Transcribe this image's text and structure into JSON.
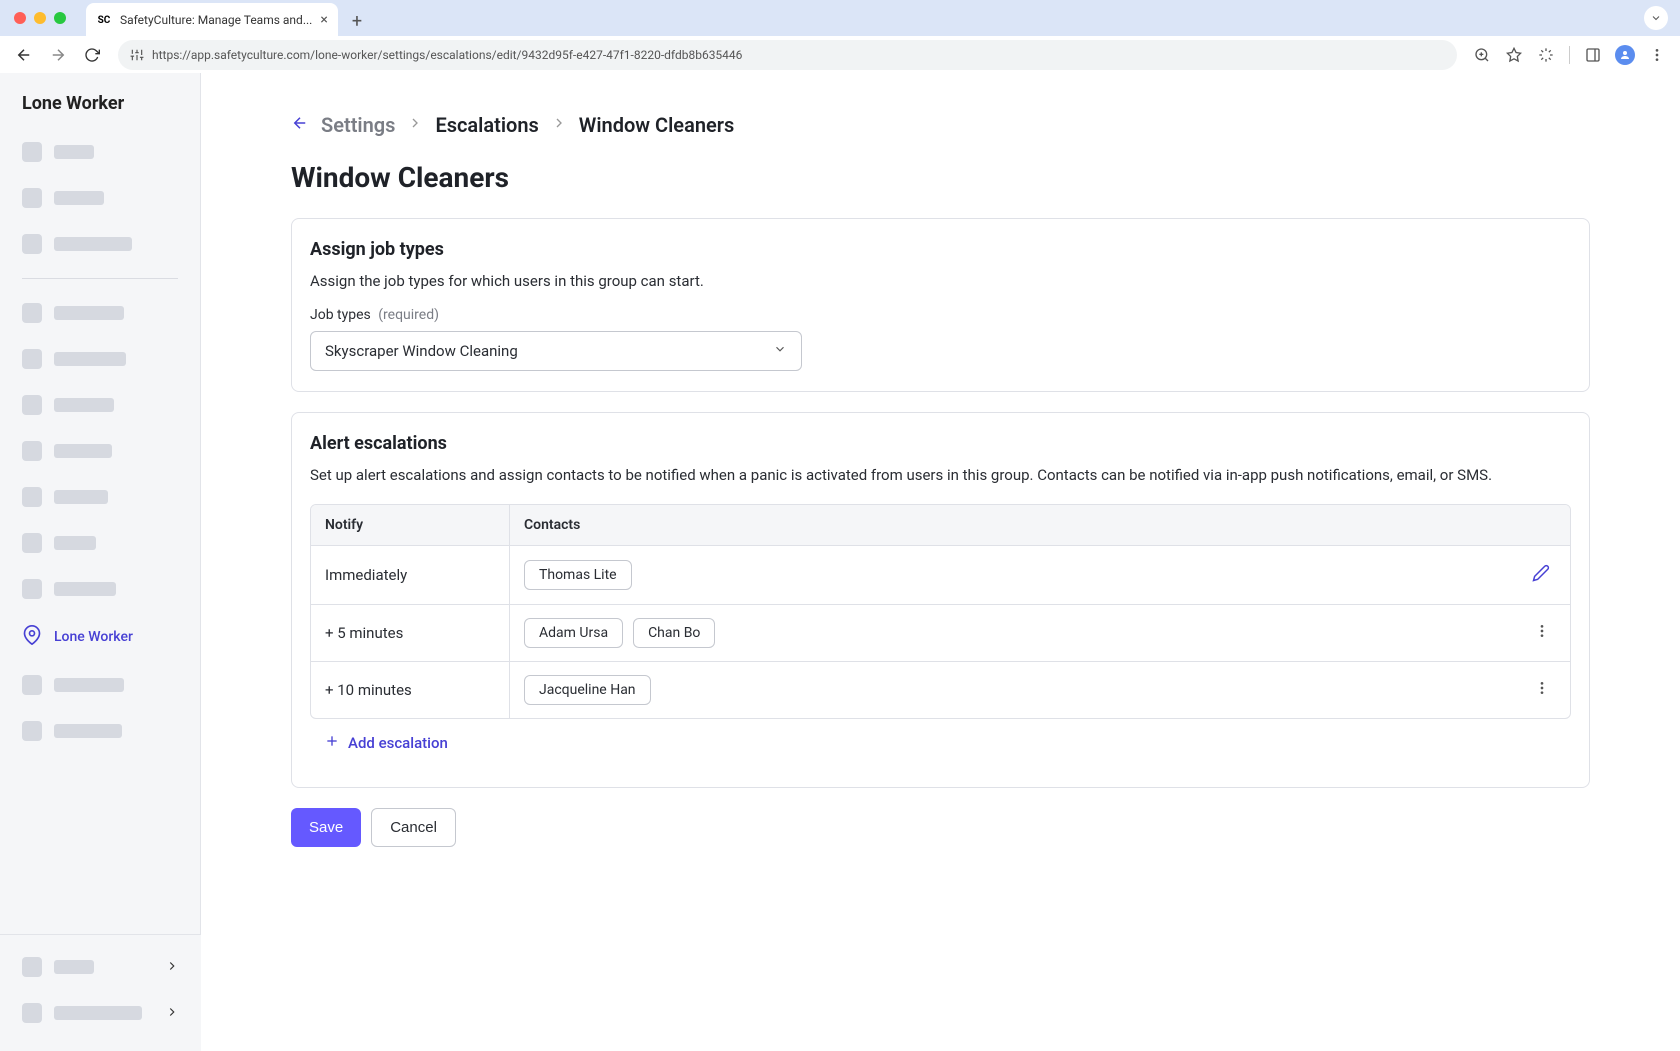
{
  "browser": {
    "tab_title": "SafetyCulture: Manage Teams and...",
    "url": "https://app.safetyculture.com/lone-worker/settings/escalations/edit/9432d95f-e427-47f1-8220-dfdb8b635446"
  },
  "sidebar": {
    "title": "Lone Worker",
    "active_label": "Lone Worker"
  },
  "breadcrumb": {
    "items": [
      {
        "label": "Settings"
      },
      {
        "label": "Escalations"
      },
      {
        "label": "Window Cleaners"
      }
    ]
  },
  "page_title": "Window Cleaners",
  "job_types": {
    "title": "Assign job types",
    "description": "Assign the job types for which users in this group can start.",
    "label": "Job types",
    "required": "(required)",
    "selected": "Skyscraper Window Cleaning"
  },
  "escalations": {
    "title": "Alert escalations",
    "description": "Set up alert escalations and assign contacts to be notified when a panic is activated from users in this group. Contacts can be notified via in-app push notifications, email, or SMS.",
    "headers": {
      "notify": "Notify",
      "contacts": "Contacts"
    },
    "rows": [
      {
        "notify": "Immediately",
        "contacts": [
          "Thomas Lite"
        ],
        "action": "edit"
      },
      {
        "notify": "+ 5 minutes",
        "contacts": [
          "Adam Ursa",
          "Chan Bo"
        ],
        "action": "more"
      },
      {
        "notify": "+ 10 minutes",
        "contacts": [
          "Jacqueline Han"
        ],
        "action": "more"
      }
    ],
    "add_label": "Add escalation"
  },
  "actions": {
    "save": "Save",
    "cancel": "Cancel"
  }
}
